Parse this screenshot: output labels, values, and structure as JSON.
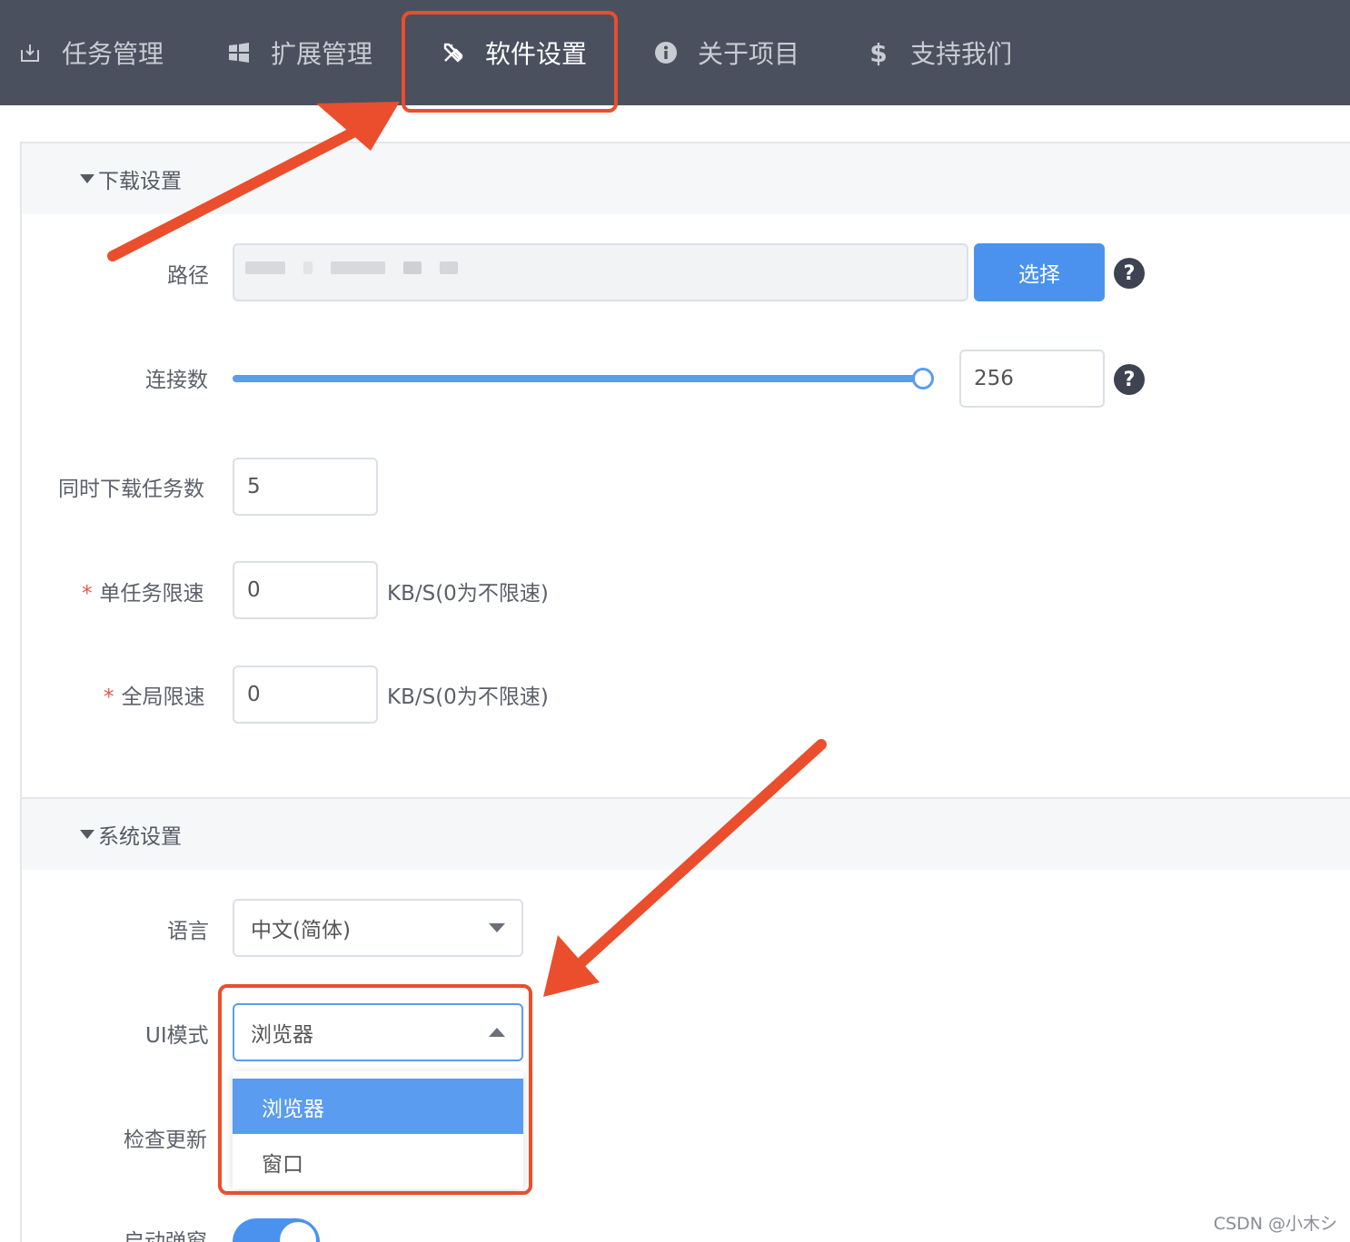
{
  "nav": {
    "items": [
      {
        "label": "任务管理",
        "icon": "download-icon"
      },
      {
        "label": "扩展管理",
        "icon": "windows-icon"
      },
      {
        "label": "软件设置",
        "icon": "tools-icon",
        "active": true
      },
      {
        "label": "关于项目",
        "icon": "info-icon"
      },
      {
        "label": "支持我们",
        "icon": "dollar-icon"
      }
    ]
  },
  "download_settings": {
    "title": "下载设置",
    "path": {
      "label": "路径",
      "button": "选择"
    },
    "connections": {
      "label": "连接数",
      "value": "256",
      "slider_fraction": 1.0
    },
    "concurrent_tasks": {
      "label": "同时下载任务数",
      "value": "5"
    },
    "task_speed": {
      "required": "*",
      "label": "单任务限速",
      "value": "0",
      "unit": "KB/S(0为不限速)"
    },
    "global_speed": {
      "required": "*",
      "label": "全局限速",
      "value": "0",
      "unit": "KB/S(0为不限速)"
    },
    "help": "?"
  },
  "system_settings": {
    "title": "系统设置",
    "language": {
      "label": "语言",
      "value": "中文(简体)"
    },
    "ui_mode": {
      "label": "UI模式",
      "value": "浏览器",
      "options": [
        "浏览器",
        "窗口"
      ]
    },
    "check_update": {
      "label": "检查更新"
    },
    "startup_popup": {
      "label": "启动弹窗",
      "enabled": true
    }
  },
  "colors": {
    "accent": "#4b92ef",
    "nav_bg": "#4a505e",
    "annotation": "#ea4e2c"
  },
  "watermark": "CSDN @小木シ"
}
